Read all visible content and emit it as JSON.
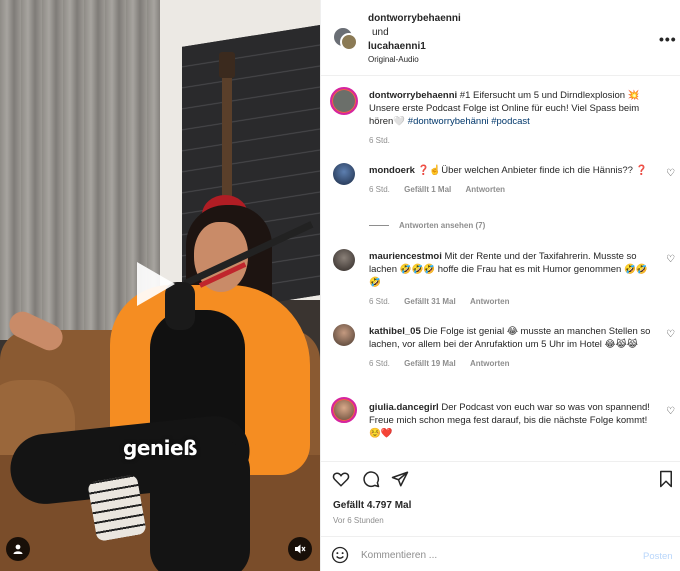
{
  "video": {
    "caption": "genieß",
    "play_icon": "play-icon",
    "profile_icon": "person-icon",
    "mute_icon": "speaker-muted-icon"
  },
  "header": {
    "user1": "dontworrybehaenni",
    "joiner": "und",
    "user2": "lucahaenni1",
    "audio": "Original-Audio",
    "more_icon": "more-horizontal-icon"
  },
  "caption_post": {
    "username": "dontworrybehaenni",
    "text_pre": "#1 Eifersucht um 5 und Dirndlexplosion 💥 Unsere erste Podcast Folge ist Online für euch! Viel Spass beim hören🤍",
    "tag1": "#dontworrybehänni",
    "tag2": "#podcast",
    "time": "6 Std."
  },
  "comments": [
    {
      "username": "mondoerk",
      "text": "❓☝️Über welchen Anbieter finde ich die Hännis?? ❓",
      "time": "6 Std.",
      "likes": "Gefällt 1 Mal",
      "reply": "Antworten",
      "view_replies": "Antworten ansehen (7)"
    },
    {
      "username": "mauriencestmoi",
      "text": "Mit der Rente und der Taxifahrerin. Musste so lachen 🤣🤣🤣 hoffe die Frau hat es mit Humor genommen 🤣🤣🤣",
      "time": "6 Std.",
      "likes": "Gefällt 31 Mal",
      "reply": "Antworten"
    },
    {
      "username": "kathibel_05",
      "text": "Die Folge ist genial 😂 musste an manchen Stellen so lachen, vor allem bei der Anrufaktion um 5 Uhr im Hotel 😂😹😹",
      "time": "6 Std.",
      "likes": "Gefällt 19 Mal",
      "reply": "Antworten"
    },
    {
      "username": "giulia.dancegirl",
      "text": "Der Podcast von euch war so was von spannend!",
      "text2": "Freue mich schon mega fest darauf, bis die nächste Folge kommt! ☺️❤️"
    }
  ],
  "actions": {
    "like_icon": "heart-icon",
    "comment_icon": "comment-icon",
    "share_icon": "send-icon",
    "save_icon": "bookmark-icon",
    "likes": "Gefällt 4.797 Mal",
    "time": "Vor 6 Stunden"
  },
  "composer": {
    "placeholder": "Kommentieren ...",
    "post_label": "Posten",
    "emoji_icon": "emoji-icon"
  },
  "colors": {
    "link": "#00376b",
    "muted": "#8e8e8e",
    "post_disabled": "#b8d6fb",
    "jacket": "#f58d22"
  }
}
